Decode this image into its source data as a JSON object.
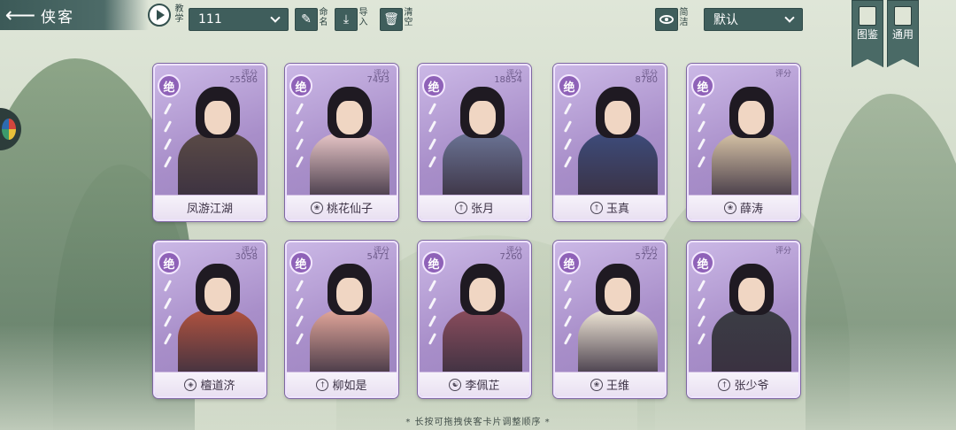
{
  "header": {
    "title": "侠客",
    "tutorial_label": "教学",
    "preset_value": "111",
    "name_label": "命名",
    "import_label": "导入",
    "clear_label": "清空",
    "simple_label": "简洁",
    "sort_value": "默认",
    "codex_label": "图鉴",
    "general_label": "通用"
  },
  "score_label": "评分",
  "cards": [
    {
      "rank": "绝",
      "score": "25586",
      "name": "凤游江湖",
      "faction_icon": "",
      "accent": "#5a4a46"
    },
    {
      "rank": "绝",
      "score": "7493",
      "name": "桃花仙子",
      "faction_icon": "lotus-icon",
      "accent": "#e9c7c8"
    },
    {
      "rank": "绝",
      "score": "18854",
      "name": "张月",
      "faction_icon": "sword-icon",
      "accent": "#6a7394"
    },
    {
      "rank": "绝",
      "score": "8780",
      "name": "玉真",
      "faction_icon": "sword-icon",
      "accent": "#3d4b7a"
    },
    {
      "rank": "绝",
      "score": "",
      "name": "薛涛",
      "faction_icon": "lotus-icon",
      "accent": "#d7c3a6"
    },
    {
      "rank": "绝",
      "score": "3058",
      "name": "檀道济",
      "faction_icon": "shield-icon",
      "accent": "#b0523f"
    },
    {
      "rank": "绝",
      "score": "5471",
      "name": "柳如是",
      "faction_icon": "sword-icon",
      "accent": "#e2a69a"
    },
    {
      "rank": "绝",
      "score": "7260",
      "name": "李佩芷",
      "faction_icon": "yinyang-icon",
      "accent": "#8a4c5c"
    },
    {
      "rank": "绝",
      "score": "5722",
      "name": "王维",
      "faction_icon": "lotus-icon",
      "accent": "#efe6d6"
    },
    {
      "rank": "绝",
      "score": "",
      "name": "张少爷",
      "faction_icon": "sword-icon",
      "accent": "#3b3d45"
    }
  ],
  "footer_hint": "* 长按可拖拽侠客卡片调整顺序 *"
}
